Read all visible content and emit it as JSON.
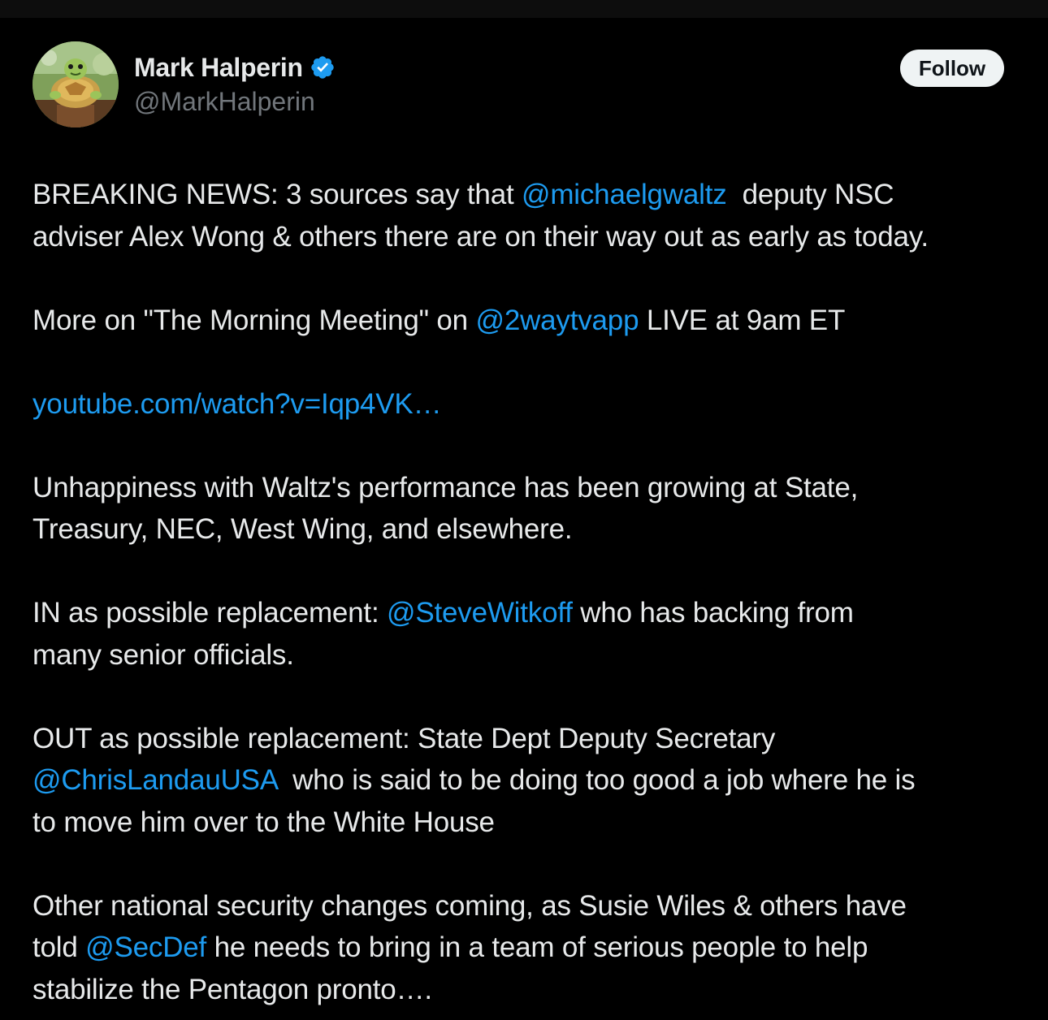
{
  "author": {
    "display_name": "Mark Halperin",
    "handle": "@MarkHalperin",
    "verified": true,
    "avatar_icon": "turtle-avatar"
  },
  "follow_button": {
    "label": "Follow"
  },
  "tweet": {
    "p1": {
      "l1_a": "BREAKING NEWS: 3 sources say that ",
      "l1_mention": "@michaelgwaltz",
      "l1_b": "  deputy NSC",
      "l2": "adviser Alex Wong & others there are on their way out as early as today."
    },
    "p2": {
      "a": "More on \"The Morning Meeting\" on ",
      "mention": "@2waytvapp",
      "b": " LIVE at 9am ET"
    },
    "p3": {
      "url": "youtube.com/watch?v=Iqp4VK…"
    },
    "p4": {
      "l1": "Unhappiness with Waltz's performance has been growing at State,",
      "l2": "Treasury, NEC, West Wing, and elsewhere."
    },
    "p5": {
      "l1_a": "IN as possible replacement: ",
      "l1_mention": "@SteveWitkoff",
      "l1_b": " who has backing from",
      "l2": "many senior officials."
    },
    "p6": {
      "l1": "OUT as possible replacement: State Dept Deputy Secretary",
      "l2_mention": "@ChrisLandauUSA",
      "l2_b": "  who is said to be doing too good a job where he is",
      "l3": "to move him over to the White House"
    },
    "p7": {
      "l1": "Other national security changes coming, as Susie Wiles & others have",
      "l2_a": "told ",
      "l2_mention": "@SecDef",
      "l2_b": " he needs to bring in a team of serious people to help",
      "l3": "stabilize the Pentagon pronto…."
    }
  },
  "colors": {
    "background": "#000000",
    "text": "#e7e9ea",
    "secondary_text": "#71767b",
    "link": "#1d9bf0",
    "follow_button_bg": "#eff3f4",
    "verified_badge": "#1d9bf0"
  }
}
